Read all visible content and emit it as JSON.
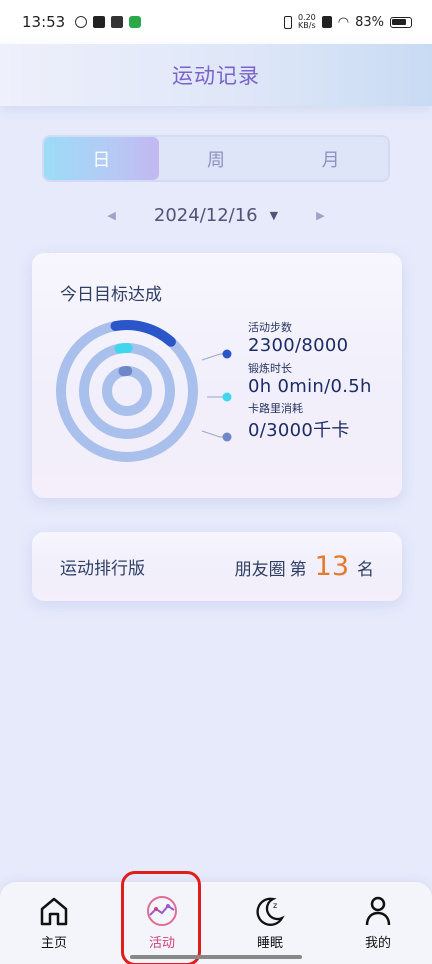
{
  "status_bar": {
    "time": "13:53",
    "speed_value": "0.20",
    "speed_unit": "KB/s",
    "battery": "83%"
  },
  "header": {
    "title": "运动记录"
  },
  "segments": [
    {
      "label": "日",
      "active": true
    },
    {
      "label": "周",
      "active": false
    },
    {
      "label": "月",
      "active": false
    }
  ],
  "date_picker": {
    "date": "2024/12/16",
    "prev_glyph": "◀",
    "next_glyph": "▶",
    "caret_glyph": "▼"
  },
  "goal_card": {
    "title": "今日目标达成",
    "metrics": [
      {
        "label": "活动步数",
        "value": "2300/8000",
        "progress": 0.2875,
        "color": "#2b56c9"
      },
      {
        "label": "锻炼时长",
        "value": "0h 0min/0.5h",
        "progress": 0.0,
        "color": "#3fd6ee"
      },
      {
        "label": "卡路里消耗",
        "value": "0/3000千卡",
        "progress": 0.0,
        "color": "#6f86c9"
      }
    ],
    "ring_track_color": "#a9c0ec"
  },
  "rank_card": {
    "label": "运动排行版",
    "scope": "朋友圈",
    "prefix": "第",
    "rank": "13",
    "suffix": "名"
  },
  "tabbar": [
    {
      "label": "主页",
      "icon": "home-icon",
      "active": false
    },
    {
      "label": "活动",
      "icon": "activity-icon",
      "active": true
    },
    {
      "label": "睡眠",
      "icon": "sleep-moon-icon",
      "active": false
    },
    {
      "label": "我的",
      "icon": "person-icon",
      "active": false
    }
  ]
}
